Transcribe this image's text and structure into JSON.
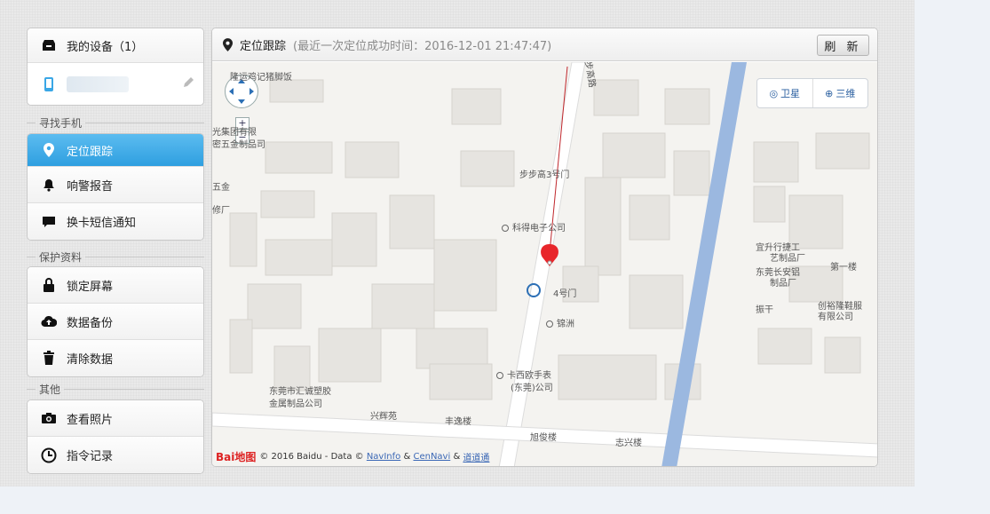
{
  "sidebar": {
    "device_group": {
      "title": "我的设备（1）",
      "device_name": ""
    },
    "find_phone_title": "寻找手机",
    "find_phone": [
      {
        "label": "定位跟踪",
        "icon": "location-pin-icon",
        "active": true
      },
      {
        "label": "响警报音",
        "icon": "bell-icon"
      },
      {
        "label": "换卡短信通知",
        "icon": "chat-bubble-icon"
      }
    ],
    "protect_title": "保护资料",
    "protect": [
      {
        "label": "锁定屏幕",
        "icon": "lock-icon"
      },
      {
        "label": "数据备份",
        "icon": "cloud-upload-icon"
      },
      {
        "label": "清除数据",
        "icon": "trash-icon"
      }
    ],
    "other_title": "其他",
    "other": [
      {
        "label": "查看照片",
        "icon": "camera-icon"
      },
      {
        "label": "指令记录",
        "icon": "clock-icon"
      }
    ]
  },
  "panel": {
    "title": "定位跟踪",
    "subtitle": "(最近一次定位成功时间：2016-12-01 21:47:47)",
    "refresh_label": "刷 新"
  },
  "map": {
    "type_buttons": [
      "卫星",
      "三维"
    ],
    "zoom_in": "+",
    "zoom_out": "−",
    "labels": {
      "l1": "隆运鸡记猪脚饭",
      "l2": "光集团有限",
      "l3": "密五金制品司",
      "l4": "五金",
      "l5": "修厂",
      "l6": "步步高3号门",
      "l7": "科得电子公司",
      "l8": "4号门",
      "l9": "锦洲",
      "l10": "卡西欧手表",
      "l11": "(东莞)公司",
      "l12": "东莞市汇诚塑胶",
      "l13": "金属制品公司",
      "l14": "兴辉苑",
      "l15": "丰逸楼",
      "l16": "旭俊楼",
      "l17": "志兴楼",
      "l18": "宜升行捷工",
      "l19": "艺制品厂",
      "l20": "东莞长安铝",
      "l21": "制品厂",
      "l22": "振干",
      "l23": "创裕隆鞋服",
      "l24": "有限公司",
      "l25": "第一楼",
      "l26": "步高路"
    },
    "copyright": {
      "logo": "Bai地图",
      "text": "© 2016 Baidu - Data ©",
      "link1": "NavInfo",
      "amp1": "&",
      "link2": "CenNavi",
      "amp2": "&",
      "link3": "道道通"
    }
  },
  "colors": {
    "active_blue": "#3aa7e6",
    "river": "#9bb8e0",
    "pin": "#e8262b"
  }
}
